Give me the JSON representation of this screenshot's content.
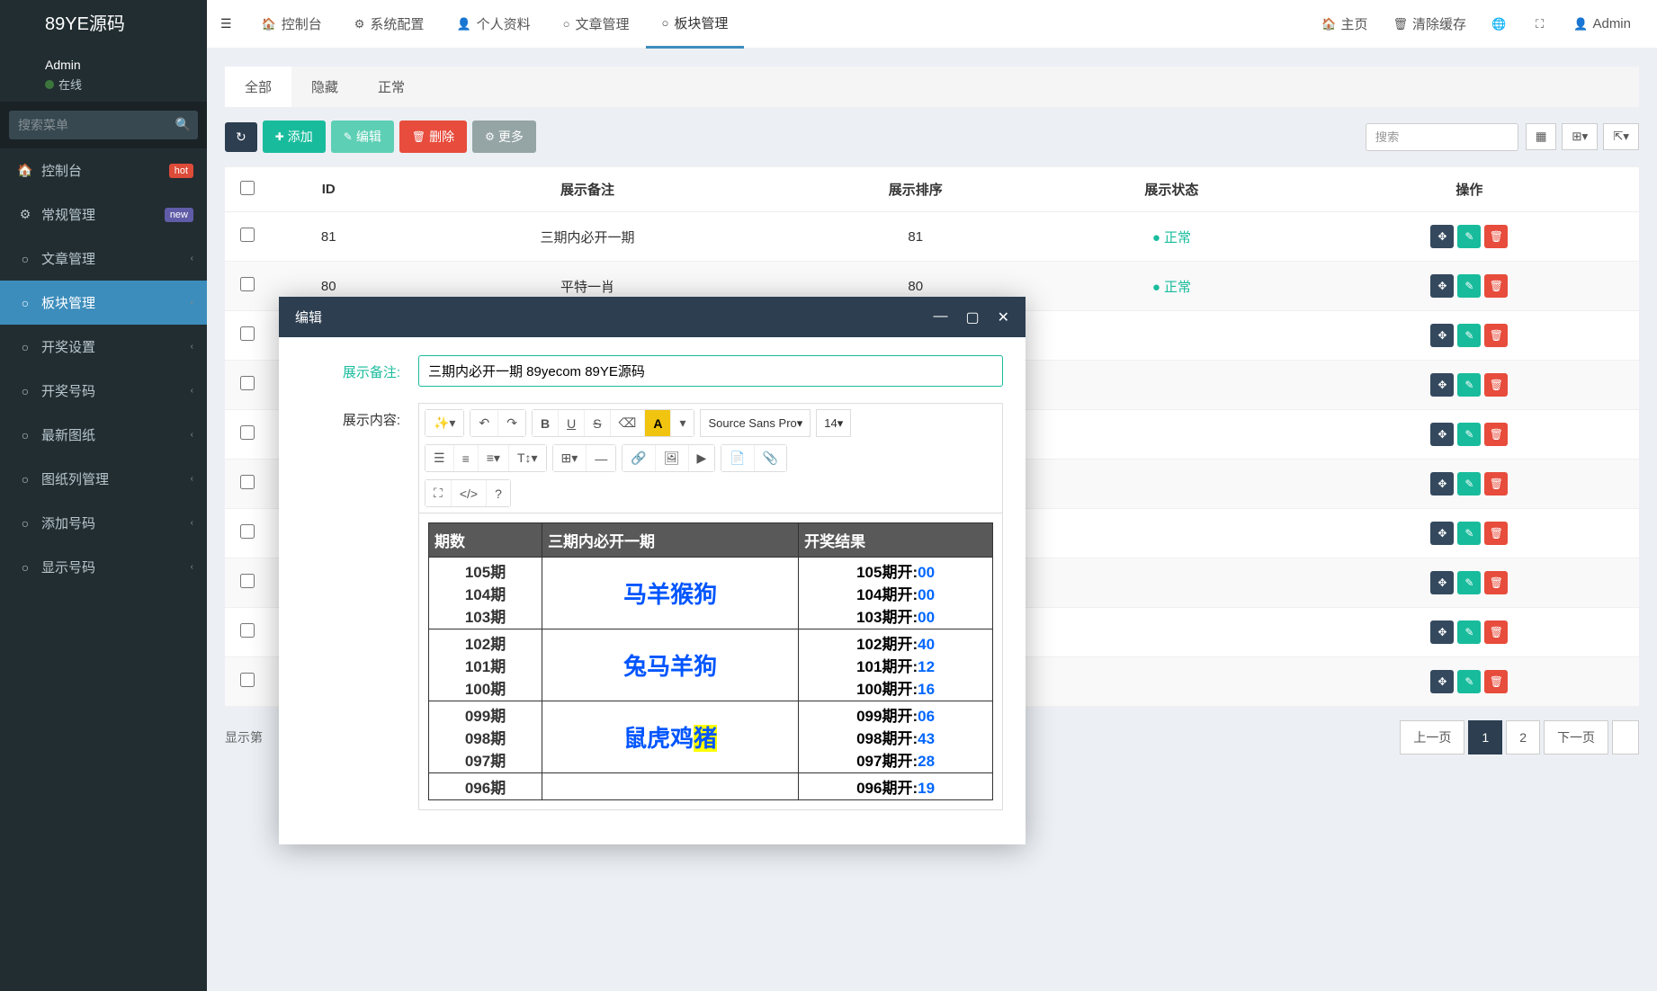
{
  "brand": "89YE源码",
  "user": {
    "name": "Admin",
    "status": "在线"
  },
  "sidebar": {
    "search_placeholder": "搜索菜单",
    "items": [
      {
        "label": "控制台",
        "icon": "dashboard",
        "badge": "hot",
        "badge_class": "badge-hot"
      },
      {
        "label": "常规管理",
        "icon": "cogs",
        "badge": "new",
        "badge_class": "badge-new"
      },
      {
        "label": "文章管理",
        "icon": "circle"
      },
      {
        "label": "板块管理",
        "icon": "circle",
        "active": true
      },
      {
        "label": "开奖设置",
        "icon": "circle"
      },
      {
        "label": "开奖号码",
        "icon": "circle"
      },
      {
        "label": "最新图纸",
        "icon": "circle"
      },
      {
        "label": "图纸列管理",
        "icon": "circle"
      },
      {
        "label": "添加号码",
        "icon": "circle"
      },
      {
        "label": "显示号码",
        "icon": "circle"
      }
    ]
  },
  "topbar": {
    "nav": [
      {
        "label": "控制台",
        "icon": "dashboard"
      },
      {
        "label": "系统配置",
        "icon": "cog"
      },
      {
        "label": "个人资料",
        "icon": "user"
      },
      {
        "label": "文章管理",
        "icon": "circle"
      },
      {
        "label": "板块管理",
        "icon": "circle",
        "active": true
      }
    ],
    "right": [
      {
        "label": "主页",
        "icon": "home"
      },
      {
        "label": "清除缓存",
        "icon": "trash"
      },
      {
        "label": "",
        "icon": "globe"
      },
      {
        "label": "",
        "icon": "expand"
      },
      {
        "label": "Admin",
        "icon": "user"
      }
    ]
  },
  "tabs": [
    {
      "label": "全部",
      "active": true
    },
    {
      "label": "隐藏"
    },
    {
      "label": "正常"
    }
  ],
  "toolbar": {
    "add": "添加",
    "edit": "编辑",
    "delete": "删除",
    "more": "更多",
    "search_placeholder": "搜索"
  },
  "table": {
    "headers": [
      "",
      "ID",
      "展示备注",
      "展示排序",
      "展示状态",
      "操作"
    ],
    "rows": [
      {
        "id": "81",
        "note": "三期内必开一期",
        "sort": "81",
        "status": "正常"
      },
      {
        "id": "80",
        "note": "平特一肖",
        "sort": "80",
        "status": "正常"
      },
      {
        "id": "",
        "note": "",
        "sort": "",
        "status": ""
      },
      {
        "id": "",
        "note": "",
        "sort": "",
        "status": ""
      },
      {
        "id": "",
        "note": "",
        "sort": "",
        "status": ""
      },
      {
        "id": "",
        "note": "",
        "sort": "",
        "status": ""
      },
      {
        "id": "",
        "note": "",
        "sort": "",
        "status": ""
      },
      {
        "id": "",
        "note": "",
        "sort": "",
        "status": ""
      },
      {
        "id": "",
        "note": "",
        "sort": "",
        "status": ""
      },
      {
        "id": "",
        "note": "",
        "sort": "",
        "status": ""
      }
    ]
  },
  "pagination": {
    "info": "显示第",
    "prev": "上一页",
    "next": "下一页",
    "pages": [
      "1",
      "2"
    ]
  },
  "modal": {
    "title": "编辑",
    "note_label": "展示备注:",
    "note_value": "三期内必开一期 89yecom 89YE源码",
    "content_label": "展示内容:",
    "font_name": "Source Sans Pro",
    "font_size": "14",
    "data_headers": [
      "期数",
      "三期内必开一期",
      "开奖结果"
    ],
    "data_rows": [
      {
        "periods": [
          "105期",
          "104期",
          "103期"
        ],
        "zodiac": "马羊猴狗",
        "hl": "",
        "results": [
          {
            "p": "105期开:",
            "n": "00"
          },
          {
            "p": "104期开:",
            "n": "00"
          },
          {
            "p": "103期开:",
            "n": "00"
          }
        ]
      },
      {
        "periods": [
          "102期",
          "101期",
          "100期"
        ],
        "zodiac": "兔马羊狗",
        "hl": "",
        "results": [
          {
            "p": "102期开:",
            "n": "40"
          },
          {
            "p": "101期开:",
            "n": "12"
          },
          {
            "p": "100期开:",
            "n": "16"
          }
        ]
      },
      {
        "periods": [
          "099期",
          "098期",
          "097期"
        ],
        "zodiac": "鼠虎鸡",
        "hl": "猪",
        "results": [
          {
            "p": "099期开:",
            "n": "06"
          },
          {
            "p": "098期开:",
            "n": "43"
          },
          {
            "p": "097期开:",
            "n": "28"
          }
        ]
      },
      {
        "periods": [
          "096期"
        ],
        "zodiac": "",
        "hl": "",
        "results": [
          {
            "p": "096期开:",
            "n": "19"
          }
        ]
      }
    ]
  },
  "icons": {
    "dashboard": "⚙",
    "cog": "⚙",
    "cogs": "⚙",
    "user": "👤",
    "circle": "○",
    "home": "🏠",
    "trash": "🗑",
    "globe": "🌐",
    "expand": "⛶",
    "bars": "☰",
    "search": "🔍",
    "refresh": "↻",
    "plus": "+",
    "pencil": "✎",
    "trash2": "🗑",
    "move": "✥",
    "chevron": "‹",
    "minimize": "—",
    "maximize": "▢",
    "close": "✕"
  }
}
